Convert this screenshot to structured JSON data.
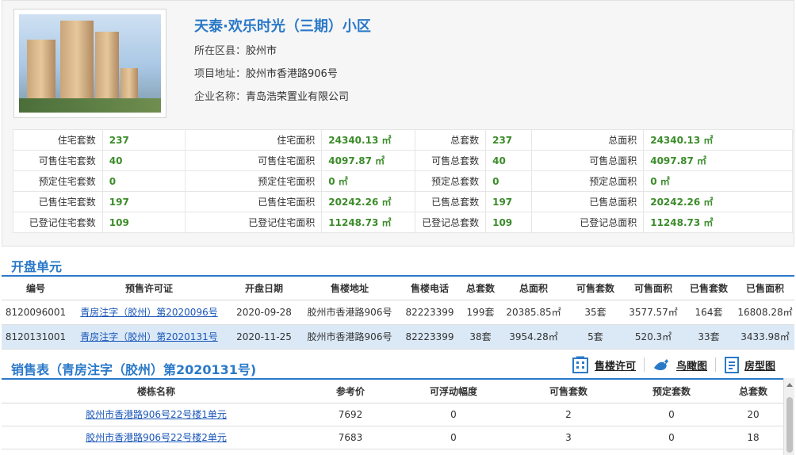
{
  "project": {
    "title": "天泰·欢乐时光（三期）小区",
    "district_label": "所在区县：",
    "district": "胶州市",
    "address_label": "项目地址：",
    "address": "胶州市香港路906号",
    "company_label": "企业名称：",
    "company": "青岛浩荣置业有限公司"
  },
  "stats": [
    [
      {
        "k": "住宅套数",
        "v": "237"
      },
      {
        "k": "住宅面积",
        "v": "24340.13 ㎡"
      },
      {
        "k": "总套数",
        "v": "237"
      },
      {
        "k": "总面积",
        "v": "24340.13 ㎡"
      }
    ],
    [
      {
        "k": "可售住宅套数",
        "v": "40"
      },
      {
        "k": "可售住宅面积",
        "v": "4097.87 ㎡"
      },
      {
        "k": "可售总套数",
        "v": "40"
      },
      {
        "k": "可售总面积",
        "v": "4097.87 ㎡"
      }
    ],
    [
      {
        "k": "预定住宅套数",
        "v": "0"
      },
      {
        "k": "预定住宅面积",
        "v": "0 ㎡"
      },
      {
        "k": "预定总套数",
        "v": "0"
      },
      {
        "k": "预定总面积",
        "v": "0 ㎡"
      }
    ],
    [
      {
        "k": "已售住宅套数",
        "v": "197"
      },
      {
        "k": "已售住宅面积",
        "v": "20242.26 ㎡"
      },
      {
        "k": "已售总套数",
        "v": "197"
      },
      {
        "k": "已售总面积",
        "v": "20242.26 ㎡"
      }
    ],
    [
      {
        "k": "已登记住宅套数",
        "v": "109"
      },
      {
        "k": "已登记住宅面积",
        "v": "11248.73 ㎡"
      },
      {
        "k": "已登记总套数",
        "v": "109"
      },
      {
        "k": "已登记总面积",
        "v": "11248.73 ㎡"
      }
    ]
  ],
  "units_section": {
    "title": "开盘单元",
    "headers": [
      "编号",
      "预售许可证",
      "开盘日期",
      "售楼地址",
      "售楼电话",
      "总套数",
      "总面积",
      "可售套数",
      "可售面积",
      "已售套数",
      "已售面积"
    ],
    "rows": [
      [
        "8120096001",
        "青房注字（胶州）第2020096号",
        "2020-09-28",
        "胶州市香港路906号",
        "82223399",
        "199套",
        "20385.85㎡",
        "35套",
        "3577.57㎡",
        "164套",
        "16808.28㎡"
      ],
      [
        "8120131001",
        "青房注字（胶州）第2020131号",
        "2020-11-25",
        "胶州市香港路906号",
        "82223399",
        "38套",
        "3954.28㎡",
        "5套",
        "520.3㎡",
        "33套",
        "3433.98㎡"
      ]
    ]
  },
  "sales_section": {
    "title": "销售表（青房注字（胶州）第2020131号)",
    "tools": {
      "permit": "售楼许可",
      "aerial": "鸟瞰图",
      "floorplan": "房型图"
    },
    "headers": [
      "楼栋名称",
      "参考价",
      "可浮动幅度",
      "可售套数",
      "预定套数",
      "总套数"
    ],
    "rows": [
      [
        "胶州市香港路906号22号楼1单元",
        "7692",
        "0",
        "2",
        "0",
        "20"
      ],
      [
        "胶州市香港路906号22号楼2单元",
        "7683",
        "0",
        "3",
        "0",
        "18"
      ]
    ]
  },
  "colors": {
    "accent": "#2a79c9",
    "value_green": "#3b8c2a",
    "link": "#1a56b8",
    "selected_row": "#dbe9f7"
  },
  "icons": {
    "permit": "building-icon",
    "aerial": "bird-icon",
    "floorplan": "document-icon"
  }
}
